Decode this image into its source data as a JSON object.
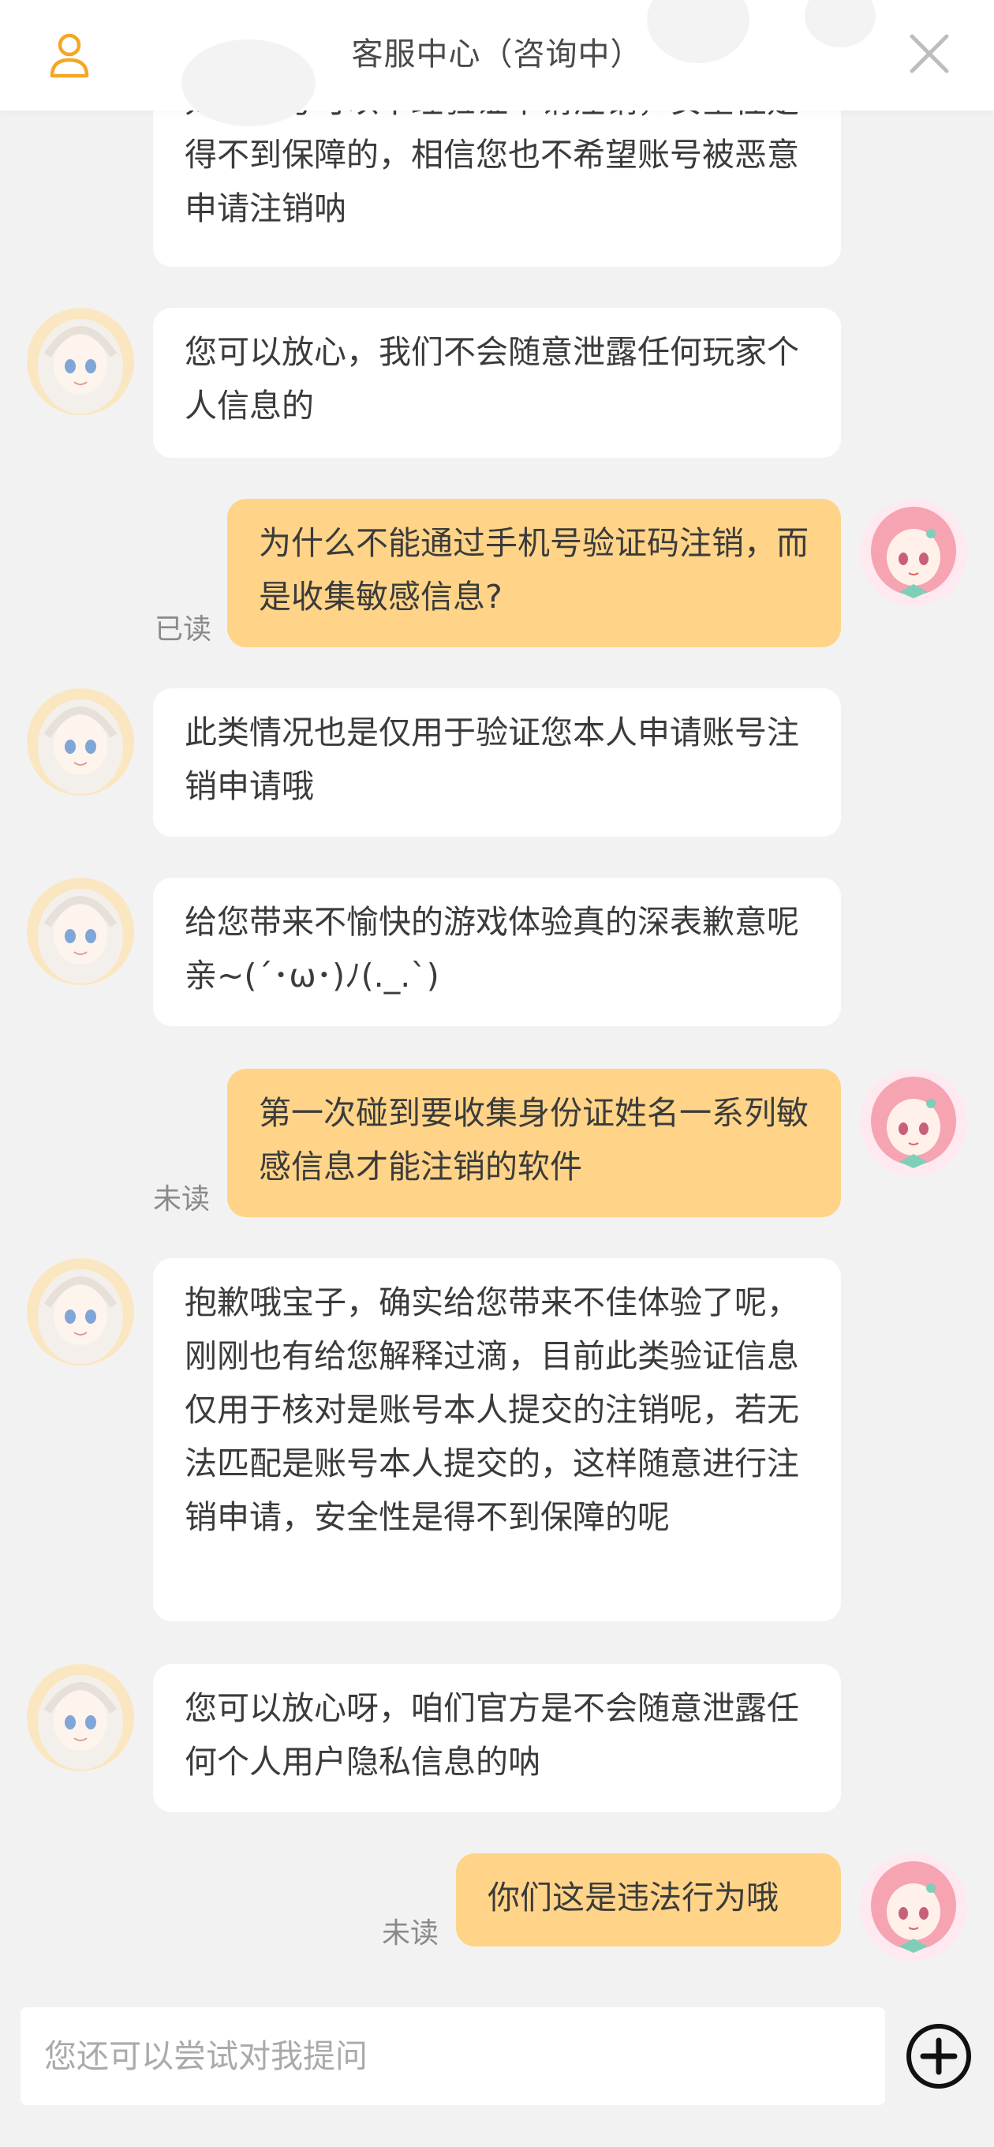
{
  "header": {
    "title": "客服中心（咨询中）",
    "left_icon": "user-icon",
    "right_icon": "close-icon",
    "accent_color": "#f5a623"
  },
  "messages": [
    {
      "sender": "agent",
      "text": "如果账号可以不经验证申请注销，安全性是得不到保障的，相信您也不希望账号被恶意申请注销呐",
      "partially_visible": true
    },
    {
      "sender": "agent",
      "text": "您可以放心，我们不会随意泄露任何玩家个人信息的"
    },
    {
      "sender": "user",
      "text": "为什么不能通过手机号验证码注销，而是收集敏感信息?",
      "status": "已读"
    },
    {
      "sender": "agent",
      "text": "此类情况也是仅用于验证您本人申请账号注销申请哦"
    },
    {
      "sender": "agent",
      "text": "给您带来不愉快的游戏体验真的深表歉意呢亲~(´･ω･)ﾉ(._.`)"
    },
    {
      "sender": "user",
      "text": "第一次碰到要收集身份证姓名一系列敏感信息才能注销的软件",
      "status": "未读"
    },
    {
      "sender": "agent",
      "text": "抱歉哦宝子，确实给您带来不佳体验了呢，刚刚也有给您解释过滴，目前此类验证信息仅用于核对是账号本人提交的注销呢，若无法匹配是账号本人提交的，这样随意进行注销申请，安全性是得不到保障的呢"
    },
    {
      "sender": "agent",
      "text": "您可以放心呀，咱们官方是不会随意泄露任何个人用户隐私信息的呐"
    },
    {
      "sender": "user",
      "text": "你们这是违法行为哦",
      "status": "未读"
    }
  ],
  "input": {
    "placeholder": "您还可以尝试对我提问"
  },
  "add_button_icon": "plus-circle-icon",
  "colors": {
    "user_bubble": "#ffd488",
    "agent_bubble": "#ffffff",
    "background": "#f2f2f2"
  }
}
